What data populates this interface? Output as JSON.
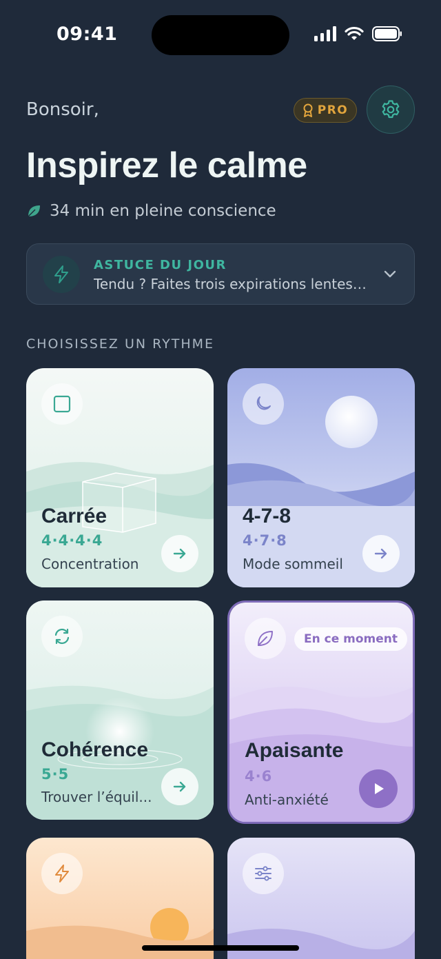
{
  "status": {
    "time": "09:41"
  },
  "header": {
    "greeting": "Bonsoir,",
    "pro_label": "PRO",
    "title": "Inspirez le calme",
    "mindful_text": "34 min en pleine conscience"
  },
  "tip": {
    "title": "ASTUCE DU JOUR",
    "text": "Tendu ? Faites trois expirations lentes,..."
  },
  "section_label": "CHOISISSEZ UN RYTHME",
  "cards": [
    {
      "title": "Carrée",
      "pattern": "4·4·4·4",
      "subtitle": "Concentration",
      "icon": "square-icon",
      "accent": "#3aa893"
    },
    {
      "title": "4-7-8",
      "pattern": "4·7·8",
      "subtitle": "Mode sommeil",
      "icon": "moon-icon",
      "accent": "#7b84c9"
    },
    {
      "title": "Cohérence",
      "pattern": "5·5",
      "subtitle": "Trouver l’équil...",
      "icon": "sync-icon",
      "accent": "#3aa893"
    },
    {
      "title": "Apaisante",
      "pattern": "4·6",
      "subtitle": "Anti-anxiété",
      "icon": "leaf-icon",
      "accent": "#9a82cf",
      "badge": "En ce moment"
    },
    {
      "icon": "bolt-icon"
    },
    {
      "icon": "sliders-icon"
    }
  ],
  "colors": {
    "background": "#1f2a3a",
    "teal_accent": "#3fb6a0",
    "gold_accent": "#e2a53d",
    "lavender_accent": "#8e70c6"
  }
}
